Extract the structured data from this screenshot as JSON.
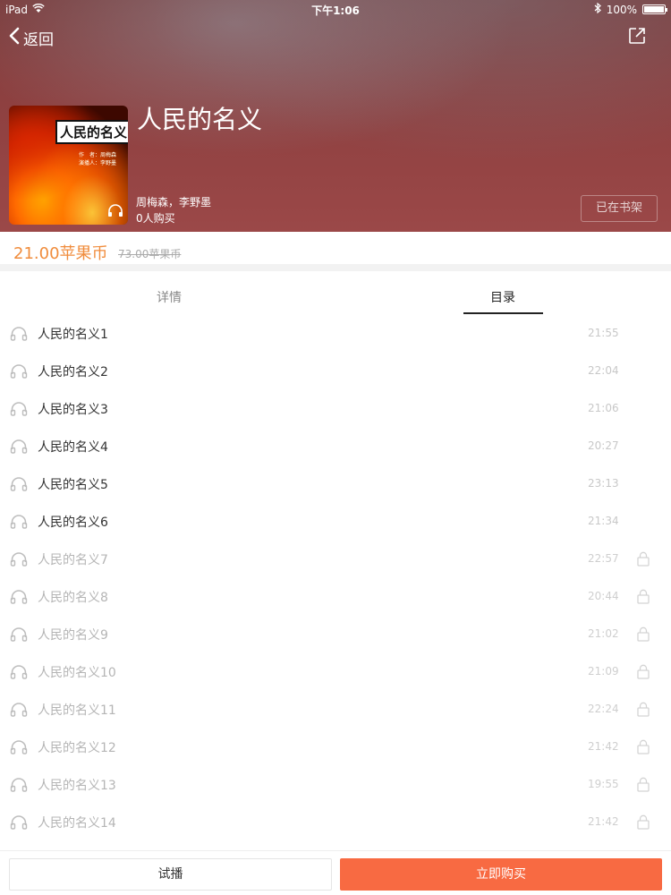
{
  "status_bar": {
    "device": "iPad",
    "time": "下午1:06",
    "battery": "100%"
  },
  "nav": {
    "back_label": "返回"
  },
  "book": {
    "title": "人民的名义",
    "author": "周梅森，李野墨",
    "buyers": "0人购买",
    "shelf_label": "已在书架",
    "cover_title": "人民的名义",
    "cover_author": "作　者：周梅森",
    "cover_narrator": "演播人：李野墨"
  },
  "price": {
    "current": "21.00苹果币",
    "original": "73.00苹果币"
  },
  "tabs": {
    "detail": "详情",
    "catalog": "目录"
  },
  "chapters": [
    {
      "name": "人民的名义1",
      "time": "21:55",
      "locked": false
    },
    {
      "name": "人民的名义2",
      "time": "22:04",
      "locked": false
    },
    {
      "name": "人民的名义3",
      "time": "21:06",
      "locked": false
    },
    {
      "name": "人民的名义4",
      "time": "20:27",
      "locked": false
    },
    {
      "name": "人民的名义5",
      "time": "23:13",
      "locked": false
    },
    {
      "name": "人民的名义6",
      "time": "21:34",
      "locked": false
    },
    {
      "name": "人民的名义7",
      "time": "22:57",
      "locked": true
    },
    {
      "name": "人民的名义8",
      "time": "20:44",
      "locked": true
    },
    {
      "name": "人民的名义9",
      "time": "21:02",
      "locked": true
    },
    {
      "name": "人民的名义10",
      "time": "21:09",
      "locked": true
    },
    {
      "name": "人民的名义11",
      "time": "22:24",
      "locked": true
    },
    {
      "name": "人民的名义12",
      "time": "21:42",
      "locked": true
    },
    {
      "name": "人民的名义13",
      "time": "19:55",
      "locked": true
    },
    {
      "name": "人民的名义14",
      "time": "21:42",
      "locked": true
    }
  ],
  "actions": {
    "trial_label": "试播",
    "buy_label": "立即购买"
  },
  "colors": {
    "accent": "#f86a42",
    "price": "#f08c3c"
  }
}
